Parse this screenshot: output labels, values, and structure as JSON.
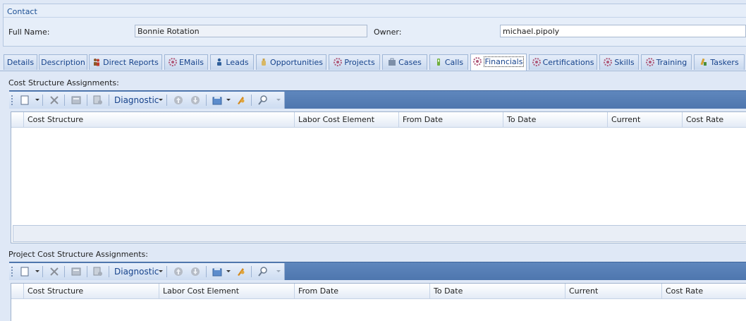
{
  "contact": {
    "title": "Contact",
    "full_name_label": "Full Name:",
    "full_name_value": "Bonnie Rotation",
    "owner_label": "Owner:",
    "owner_value": "michael.pipoly"
  },
  "tabs": [
    {
      "label": "Details",
      "icon": "none"
    },
    {
      "label": "Description",
      "icon": "none"
    },
    {
      "label": "Direct Reports",
      "icon": "people-icon"
    },
    {
      "label": "EMails",
      "icon": "gear-icon"
    },
    {
      "label": "Leads",
      "icon": "person-icon"
    },
    {
      "label": "Opportunities",
      "icon": "bottle-icon"
    },
    {
      "label": "Projects",
      "icon": "gear-icon"
    },
    {
      "label": "Cases",
      "icon": "briefcase-icon"
    },
    {
      "label": "Calls",
      "icon": "phone-icon"
    },
    {
      "label": "Financials",
      "icon": "gear-icon",
      "active": true
    },
    {
      "label": "Certifications",
      "icon": "gear-icon"
    },
    {
      "label": "Skills",
      "icon": "gear-icon"
    },
    {
      "label": "Training",
      "icon": "gear-icon"
    },
    {
      "label": "Taskers",
      "icon": "pencil-icon"
    }
  ],
  "toolbar": {
    "diagnostic_label": "Diagnostic"
  },
  "grid1": {
    "label": "Cost Structure Assignments:",
    "columns": [
      "Cost Structure",
      "Labor Cost Element",
      "From Date",
      "To Date",
      "Current",
      "Cost Rate"
    ]
  },
  "grid2": {
    "label": "Project Cost Structure Assignments:",
    "columns": [
      "Cost Structure",
      "Labor Cost Element",
      "From Date",
      "To Date",
      "Current",
      "Cost Rate"
    ]
  },
  "colors": {
    "accent": "#15428b",
    "toolbar": "#5a82b9",
    "background": "#dfe8f6"
  }
}
